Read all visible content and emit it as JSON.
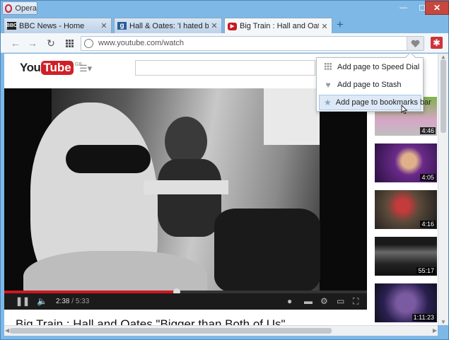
{
  "browser": {
    "menu_label": "Opera",
    "window_controls": {
      "minimize": "—",
      "maximize": "☐",
      "close": "✕"
    }
  },
  "tabs": [
    {
      "title": "BBC News - Home",
      "favicon": "bbc-favicon",
      "active": false
    },
    {
      "title": "Hall & Oates: 'I hated bein",
      "favicon": "guardian-favicon",
      "active": false
    },
    {
      "title": "Big Train : Hall and Oates",
      "favicon": "youtube-favicon",
      "active": true
    }
  ],
  "new_tab_label": "+",
  "address_bar": {
    "url": "www.youtube.com/watch"
  },
  "stash_popup": {
    "items": [
      {
        "label": "Add page to Speed Dial",
        "icon": "speed-dial-icon"
      },
      {
        "label": "Add page to Stash",
        "icon": "heart-icon"
      },
      {
        "label": "Add page to bookmarks bar",
        "icon": "star-icon",
        "hovered": true
      }
    ]
  },
  "youtube": {
    "logo_you": "You",
    "logo_tube": "Tube",
    "region": "GB",
    "player": {
      "current_time": "2:38",
      "duration": "5:33",
      "progress_fraction": 0.475
    },
    "video_title": "Big Train : Hall and Oates \"Bigger than Both of Us\"",
    "related_thumbnails": [
      {
        "duration": "4:46"
      },
      {
        "duration": "4:05"
      },
      {
        "duration": "4:16"
      },
      {
        "duration": "55:17"
      },
      {
        "duration": "1:11:23"
      }
    ]
  },
  "colors": {
    "titlebar": "#7eb8e6",
    "close_button": "#c7463d",
    "youtube_red": "#cc181e",
    "opera_red": "#d2202f"
  }
}
